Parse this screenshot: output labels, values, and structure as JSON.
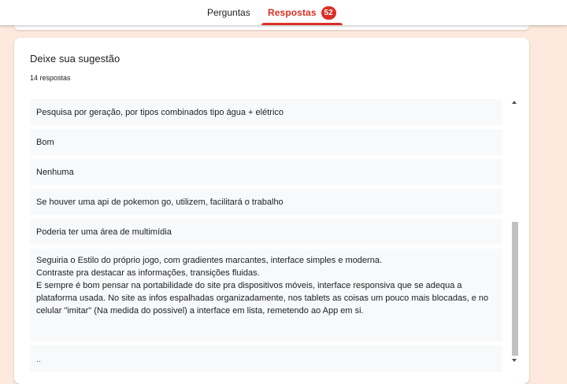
{
  "header": {
    "tabs": [
      {
        "label": "Perguntas"
      },
      {
        "label": "Respostas",
        "badge": "52"
      }
    ],
    "accent_color": "#d93025"
  },
  "card": {
    "title": "Deixe sua sugestão",
    "count": "14 respostas",
    "responses": [
      "Pesquisa por geração, por tipos combinados tipo água + elétrico",
      "Bom",
      "Nenhuma",
      "Se houver uma api de pokemon go, utilizem, facilitará o trabalho",
      "Poderia ter uma área de multimídia",
      "Seguiria o Estilo do próprio jogo, com gradientes marcantes, interface simples e moderna.\nContraste pra destacar as informações, transições fluidas.\nE sempre é bom pensar na portabilidade do site pra dispositivos móveis, interface responsiva que se adequa a plataforma usada. No site as infos espalhadas organizadamente, nos tablets as coisas um pouco mais blocadas, e no celular \"imitar\" (Na medida do possivel) a interface em lista, remetendo ao App em si.",
      ".."
    ]
  },
  "colors": {
    "background": "#fce8dc",
    "card": "#ffffff",
    "response_bg": "#f8f9fa"
  }
}
